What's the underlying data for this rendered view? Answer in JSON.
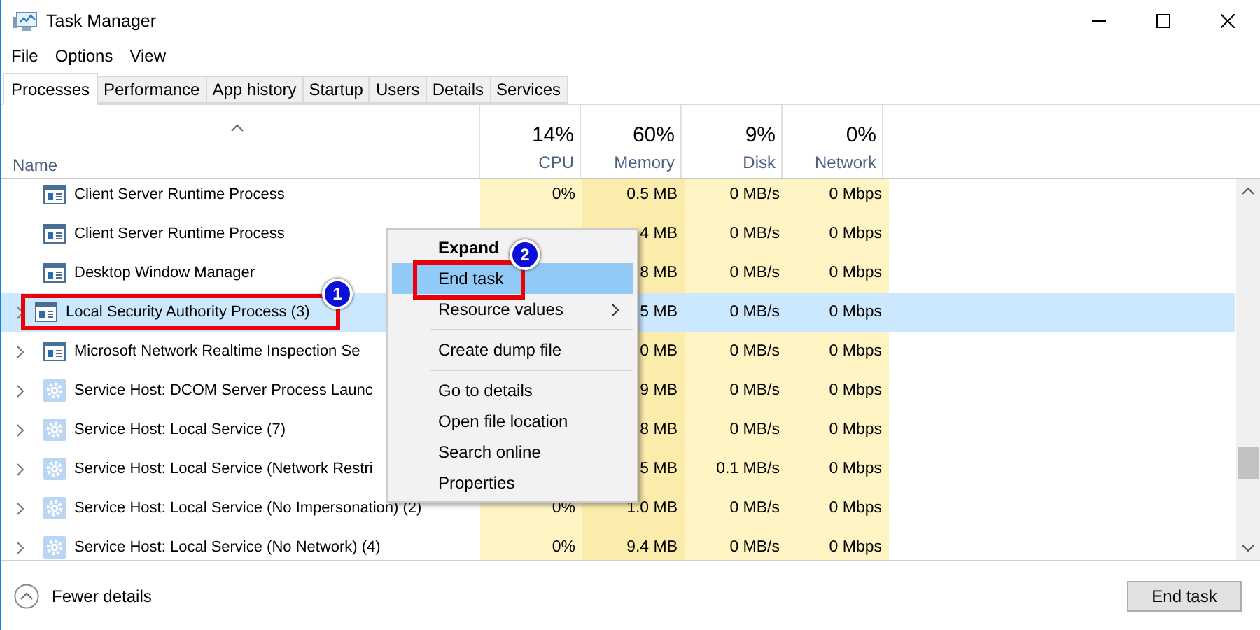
{
  "window": {
    "title": "Task Manager"
  },
  "menu_bar": [
    "File",
    "Options",
    "View"
  ],
  "tabs": [
    {
      "label": "Processes",
      "selected": true
    },
    {
      "label": "Performance",
      "selected": false
    },
    {
      "label": "App history",
      "selected": false
    },
    {
      "label": "Startup",
      "selected": false
    },
    {
      "label": "Users",
      "selected": false
    },
    {
      "label": "Details",
      "selected": false
    },
    {
      "label": "Services",
      "selected": false
    }
  ],
  "name_column": "Name",
  "columns": [
    {
      "percent": "14%",
      "label": "CPU"
    },
    {
      "percent": "60%",
      "label": "Memory"
    },
    {
      "percent": "9%",
      "label": "Disk"
    },
    {
      "percent": "0%",
      "label": "Network"
    }
  ],
  "rows": [
    {
      "kind": "app",
      "name": "Client Server Runtime Process",
      "expandable": false,
      "selected": false,
      "cells": [
        "0%",
        "0.5 MB",
        "0 MB/s",
        "0 Mbps"
      ]
    },
    {
      "kind": "app",
      "name": "Client Server Runtime Process",
      "expandable": false,
      "selected": false,
      "cells": [
        null,
        "4 MB",
        "0 MB/s",
        "0 Mbps"
      ]
    },
    {
      "kind": "app",
      "name": "Desktop Window Manager",
      "expandable": false,
      "selected": false,
      "cells": [
        null,
        "8 MB",
        "0 MB/s",
        "0 Mbps"
      ]
    },
    {
      "kind": "app",
      "name": "Local Security Authority Process (3)",
      "expandable": true,
      "selected": true,
      "annotation": "1",
      "cells": [
        null,
        "5 MB",
        "0 MB/s",
        "0 Mbps"
      ]
    },
    {
      "kind": "app",
      "name": "Microsoft Network Realtime Inspection Se",
      "expandable": true,
      "selected": false,
      "cells": [
        null,
        "0 MB",
        "0 MB/s",
        "0 Mbps"
      ]
    },
    {
      "kind": "service",
      "name": "Service Host: DCOM Server Process Launc",
      "expandable": true,
      "selected": false,
      "cells": [
        null,
        "9 MB",
        "0 MB/s",
        "0 Mbps"
      ]
    },
    {
      "kind": "service",
      "name": "Service Host: Local Service (7)",
      "expandable": true,
      "selected": false,
      "cells": [
        null,
        "8 MB",
        "0 MB/s",
        "0 Mbps"
      ]
    },
    {
      "kind": "service",
      "name": "Service Host: Local Service (Network Restri",
      "expandable": true,
      "selected": false,
      "cells": [
        null,
        "5 MB",
        "0.1 MB/s",
        "0 Mbps"
      ]
    },
    {
      "kind": "service",
      "name": "Service Host: Local Service (No Impersonation) (2)",
      "expandable": true,
      "selected": false,
      "cells": [
        "0%",
        "1.0 MB",
        "0 MB/s",
        "0 Mbps"
      ]
    },
    {
      "kind": "service",
      "name": "Service Host: Local Service (No Network) (4)",
      "expandable": true,
      "selected": false,
      "cells": [
        "0%",
        "9.4 MB",
        "0 MB/s",
        "0 Mbps"
      ]
    }
  ],
  "context_menu": [
    {
      "label": "Expand",
      "default": true,
      "selected": false,
      "submenu": false,
      "divider_after": false
    },
    {
      "label": "End task",
      "default": false,
      "selected": true,
      "submenu": false,
      "divider_after": false,
      "annotation": "2"
    },
    {
      "label": "Resource values",
      "default": false,
      "selected": false,
      "submenu": true,
      "divider_after": true
    },
    {
      "label": "Create dump file",
      "default": false,
      "selected": false,
      "submenu": false,
      "divider_after": true
    },
    {
      "label": "Go to details",
      "default": false,
      "selected": false,
      "submenu": false,
      "divider_after": false
    },
    {
      "label": "Open file location",
      "default": false,
      "selected": false,
      "submenu": false,
      "divider_after": false
    },
    {
      "label": "Search online",
      "default": false,
      "selected": false,
      "submenu": false,
      "divider_after": false
    },
    {
      "label": "Properties",
      "default": false,
      "selected": false,
      "submenu": false,
      "divider_after": false
    }
  ],
  "footer": {
    "toggle": "Fewer details",
    "button": "End task"
  }
}
